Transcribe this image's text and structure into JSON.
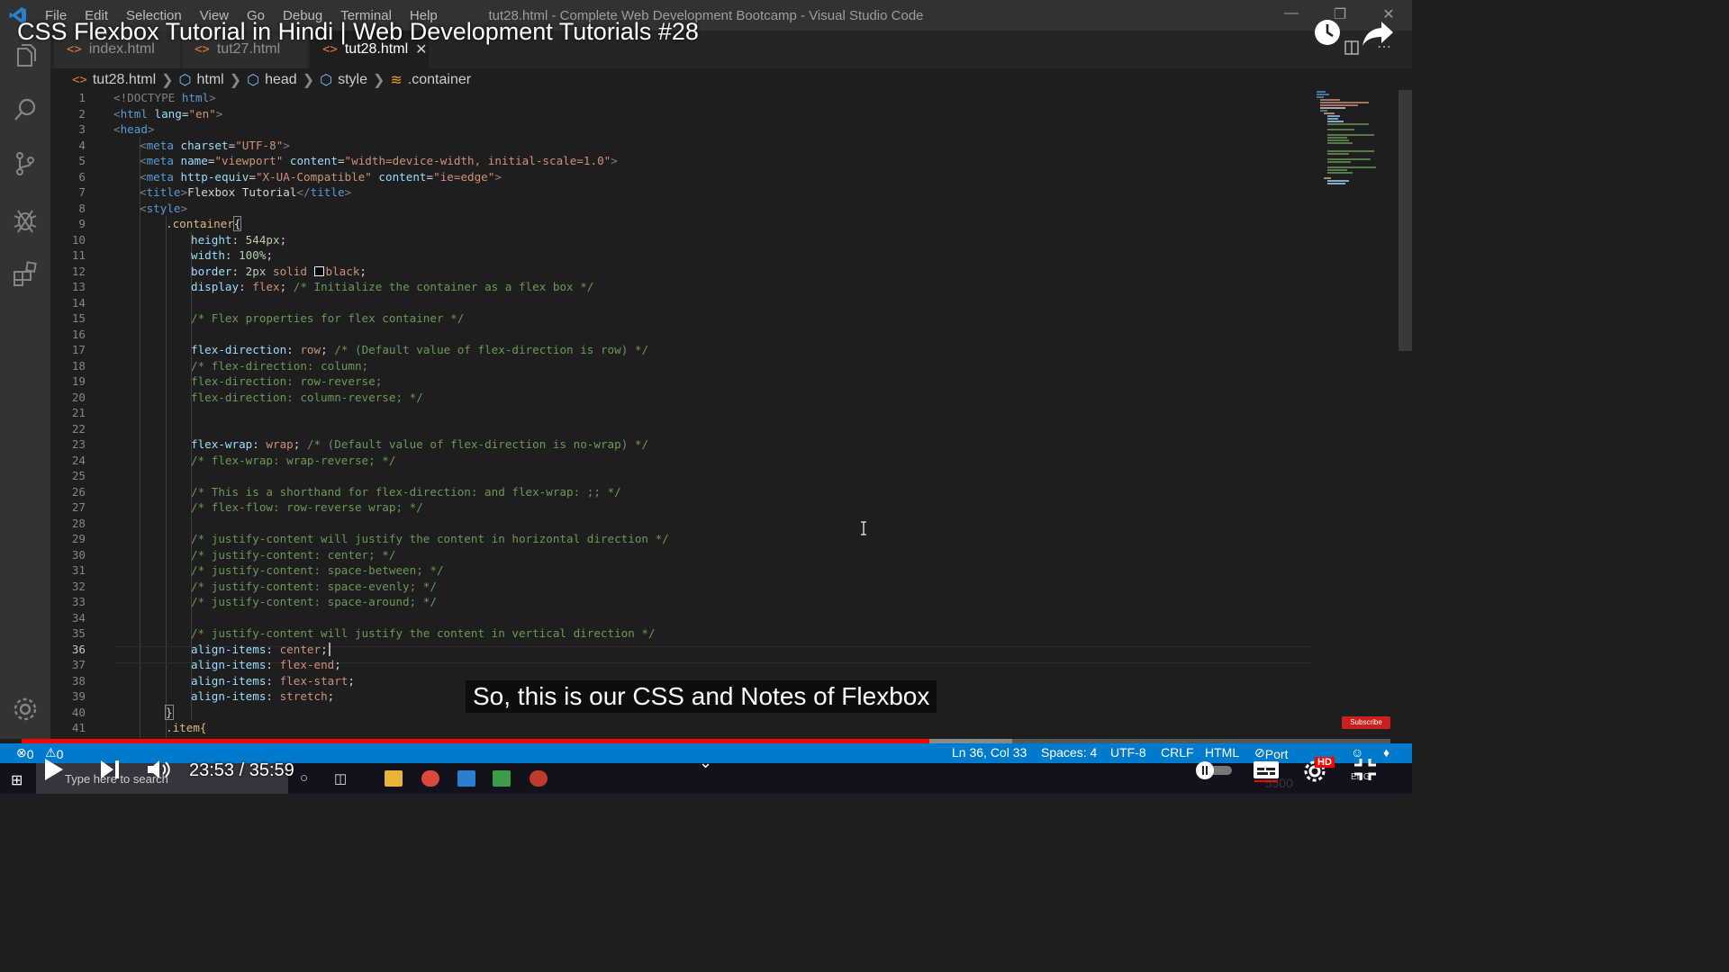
{
  "window": {
    "title": "tut28.html - Complete Web Development Bootcamp - Visual Studio Code",
    "menu": [
      "File",
      "Edit",
      "Selection",
      "View",
      "Go",
      "Debug",
      "Terminal",
      "Help"
    ]
  },
  "tabs": [
    {
      "label": "index.html",
      "active": false
    },
    {
      "label": "tut27.html",
      "active": false
    },
    {
      "label": "tut28.html",
      "active": true
    }
  ],
  "breadcrumb": [
    "tut28.html",
    "html",
    "head",
    "style",
    ".container"
  ],
  "code_lines": [
    {
      "n": "1"
    },
    {
      "n": "2"
    },
    {
      "n": "3"
    },
    {
      "n": "4"
    },
    {
      "n": "5"
    },
    {
      "n": "6"
    },
    {
      "n": "7"
    },
    {
      "n": "8"
    },
    {
      "n": "9"
    },
    {
      "n": "10"
    },
    {
      "n": "11"
    },
    {
      "n": "12"
    },
    {
      "n": "13"
    },
    {
      "n": "14"
    },
    {
      "n": "15"
    },
    {
      "n": "16"
    },
    {
      "n": "17"
    },
    {
      "n": "18"
    },
    {
      "n": "19"
    },
    {
      "n": "20"
    },
    {
      "n": "21"
    },
    {
      "n": "22"
    },
    {
      "n": "23"
    },
    {
      "n": "24"
    },
    {
      "n": "25"
    },
    {
      "n": "26"
    },
    {
      "n": "27"
    },
    {
      "n": "28"
    },
    {
      "n": "29"
    },
    {
      "n": "30"
    },
    {
      "n": "31"
    },
    {
      "n": "32"
    },
    {
      "n": "33"
    },
    {
      "n": "34"
    },
    {
      "n": "35"
    },
    {
      "n": "36"
    },
    {
      "n": "37"
    },
    {
      "n": "38"
    },
    {
      "n": "39"
    },
    {
      "n": "40"
    },
    {
      "n": "41"
    }
  ],
  "code": {
    "l1a": "<!DOCTYPE ",
    "l1b": "html",
    "l1c": ">",
    "l2a": "<",
    "l2b": "html",
    "l2c": " lang",
    "l2d": "=",
    "l2e": "\"en\"",
    "l2f": ">",
    "l3a": "<",
    "l3b": "head",
    "l3c": ">",
    "l4a": "<",
    "l4b": "meta",
    "l4c": " charset",
    "l4d": "=",
    "l4e": "\"UTF-8\"",
    "l4f": ">",
    "l5a": "<",
    "l5b": "meta",
    "l5c": " name",
    "l5d": "=",
    "l5e": "\"viewport\"",
    "l5f": " content",
    "l5g": "=",
    "l5h": "\"width=device-width, initial-scale=1.0\"",
    "l5i": ">",
    "l6a": "<",
    "l6b": "meta",
    "l6c": " http-equiv",
    "l6d": "=",
    "l6e": "\"X-UA-Compatible\"",
    "l6f": " content",
    "l6g": "=",
    "l6h": "\"ie=edge\"",
    "l6i": ">",
    "l7a": "<",
    "l7b": "title",
    "l7c": ">",
    "l7d": "Flexbox Tutorial",
    "l7e": "</",
    "l7f": "title",
    "l7g": ">",
    "l8a": "<",
    "l8b": "style",
    "l8c": ">",
    "l9": ".container",
    "l9b": "{",
    "l10a": "height",
    "l10b": ": ",
    "l10c": "544px",
    "l10d": ";",
    "l11a": "width",
    "l11b": ": ",
    "l11c": "100%",
    "l11d": ";",
    "l12a": "border",
    "l12b": ": ",
    "l12c": "2px",
    "l12d": " solid ",
    "l12e": "black",
    "l12f": ";",
    "l13a": "display",
    "l13b": ": ",
    "l13c": "flex",
    "l13d": "; ",
    "l13e": "/* Initialize the container as a flex box */",
    "l15": "/* Flex properties for flex container */",
    "l17a": "flex-direction",
    "l17b": ": ",
    "l17c": "row",
    "l17d": "; ",
    "l17e": "/* (Default value of flex-direction is row) */",
    "l18": "/* flex-direction: column;",
    "l19": "flex-direction: row-reverse;",
    "l20": "flex-direction: column-reverse; */",
    "l23a": "flex-wrap",
    "l23b": ": ",
    "l23c": "wrap",
    "l23d": "; ",
    "l23e": "/* (Default value of flex-direction is no-wrap) */",
    "l24": "/* flex-wrap: wrap-reverse; */",
    "l26": "/* This is a shorthand for flex-direction: and flex-wrap: ;; */",
    "l27": "/* flex-flow: row-reverse wrap; */",
    "l29": "/* justify-content will justify the content in horizontal direction */",
    "l30": "/* justify-content: center; */",
    "l31": "/* justify-content: space-between; */",
    "l32": "/* justify-content: space-evenly; */",
    "l33": "/* justify-content: space-around; */",
    "l35": "/* justify-content will justify the content in vertical direction */",
    "l36a": "align-items",
    "l36b": ": ",
    "l36c": "center",
    "l36d": ";",
    "l37a": "align-items",
    "l37b": ": ",
    "l37c": "flex-end",
    "l37d": ";",
    "l38a": "align-items",
    "l38b": ": ",
    "l38c": "flex-start",
    "l38d": ";",
    "l39a": "align-items",
    "l39b": ": ",
    "l39c": "stretch",
    "l39d": ";",
    "l40": "}",
    "l41": ".item{"
  },
  "status": {
    "errors": "0",
    "warnings": "0",
    "position": "Ln 36, Col 33",
    "spaces": "Spaces: 4",
    "encoding": "UTF-8",
    "eol": "CRLF",
    "language": "HTML",
    "port": "Port : 5500"
  },
  "youtube": {
    "video_title": "CSS Flexbox Tutorial in Hindi | Web Development Tutorials #28",
    "caption": "So, this is our CSS and Notes of Flexbox",
    "time": "23:53 / 35:59",
    "played_fraction": 0.663,
    "buffered_fraction": 0.724,
    "subscribe": "Subscribe",
    "quality_badge": "HD"
  },
  "taskbar": {
    "search_placeholder": "Type here to search",
    "lang": "ENG"
  },
  "colors": {
    "status_bar": "#007acc",
    "progress": "#ff0000",
    "editor_bg": "#1e1e1e"
  }
}
